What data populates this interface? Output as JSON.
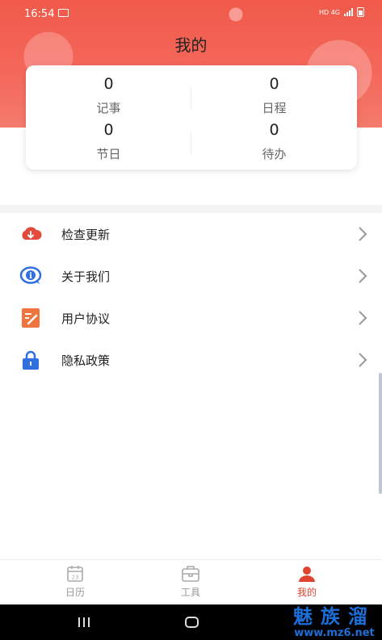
{
  "status_bar": {
    "time": "16:54",
    "indicators": "HD 4G"
  },
  "header": {
    "title": "我的"
  },
  "stats": [
    {
      "value": "0",
      "label": "记事"
    },
    {
      "value": "0",
      "label": "日程"
    },
    {
      "value": "0",
      "label": "节日"
    },
    {
      "value": "0",
      "label": "待办"
    }
  ],
  "menu": [
    {
      "label": "检查更新",
      "icon": "cloud-download-icon",
      "color": "#e24a3b"
    },
    {
      "label": "关于我们",
      "icon": "info-chat-icon",
      "color": "#2f6fe0"
    },
    {
      "label": "用户协议",
      "icon": "document-edit-icon",
      "color": "#f0743e"
    },
    {
      "label": "隐私政策",
      "icon": "lock-icon",
      "color": "#2f6fe0"
    }
  ],
  "bottom_nav": [
    {
      "label": "日历",
      "icon": "calendar-icon",
      "active": false
    },
    {
      "label": "工具",
      "icon": "toolbox-icon",
      "active": false
    },
    {
      "label": "我的",
      "icon": "user-icon",
      "active": true
    }
  ],
  "colors": {
    "accent": "#e0432f",
    "header_gradient": "#f05a4a"
  },
  "watermark": {
    "big": "魅族溜",
    "small": "www.mz6.net"
  }
}
